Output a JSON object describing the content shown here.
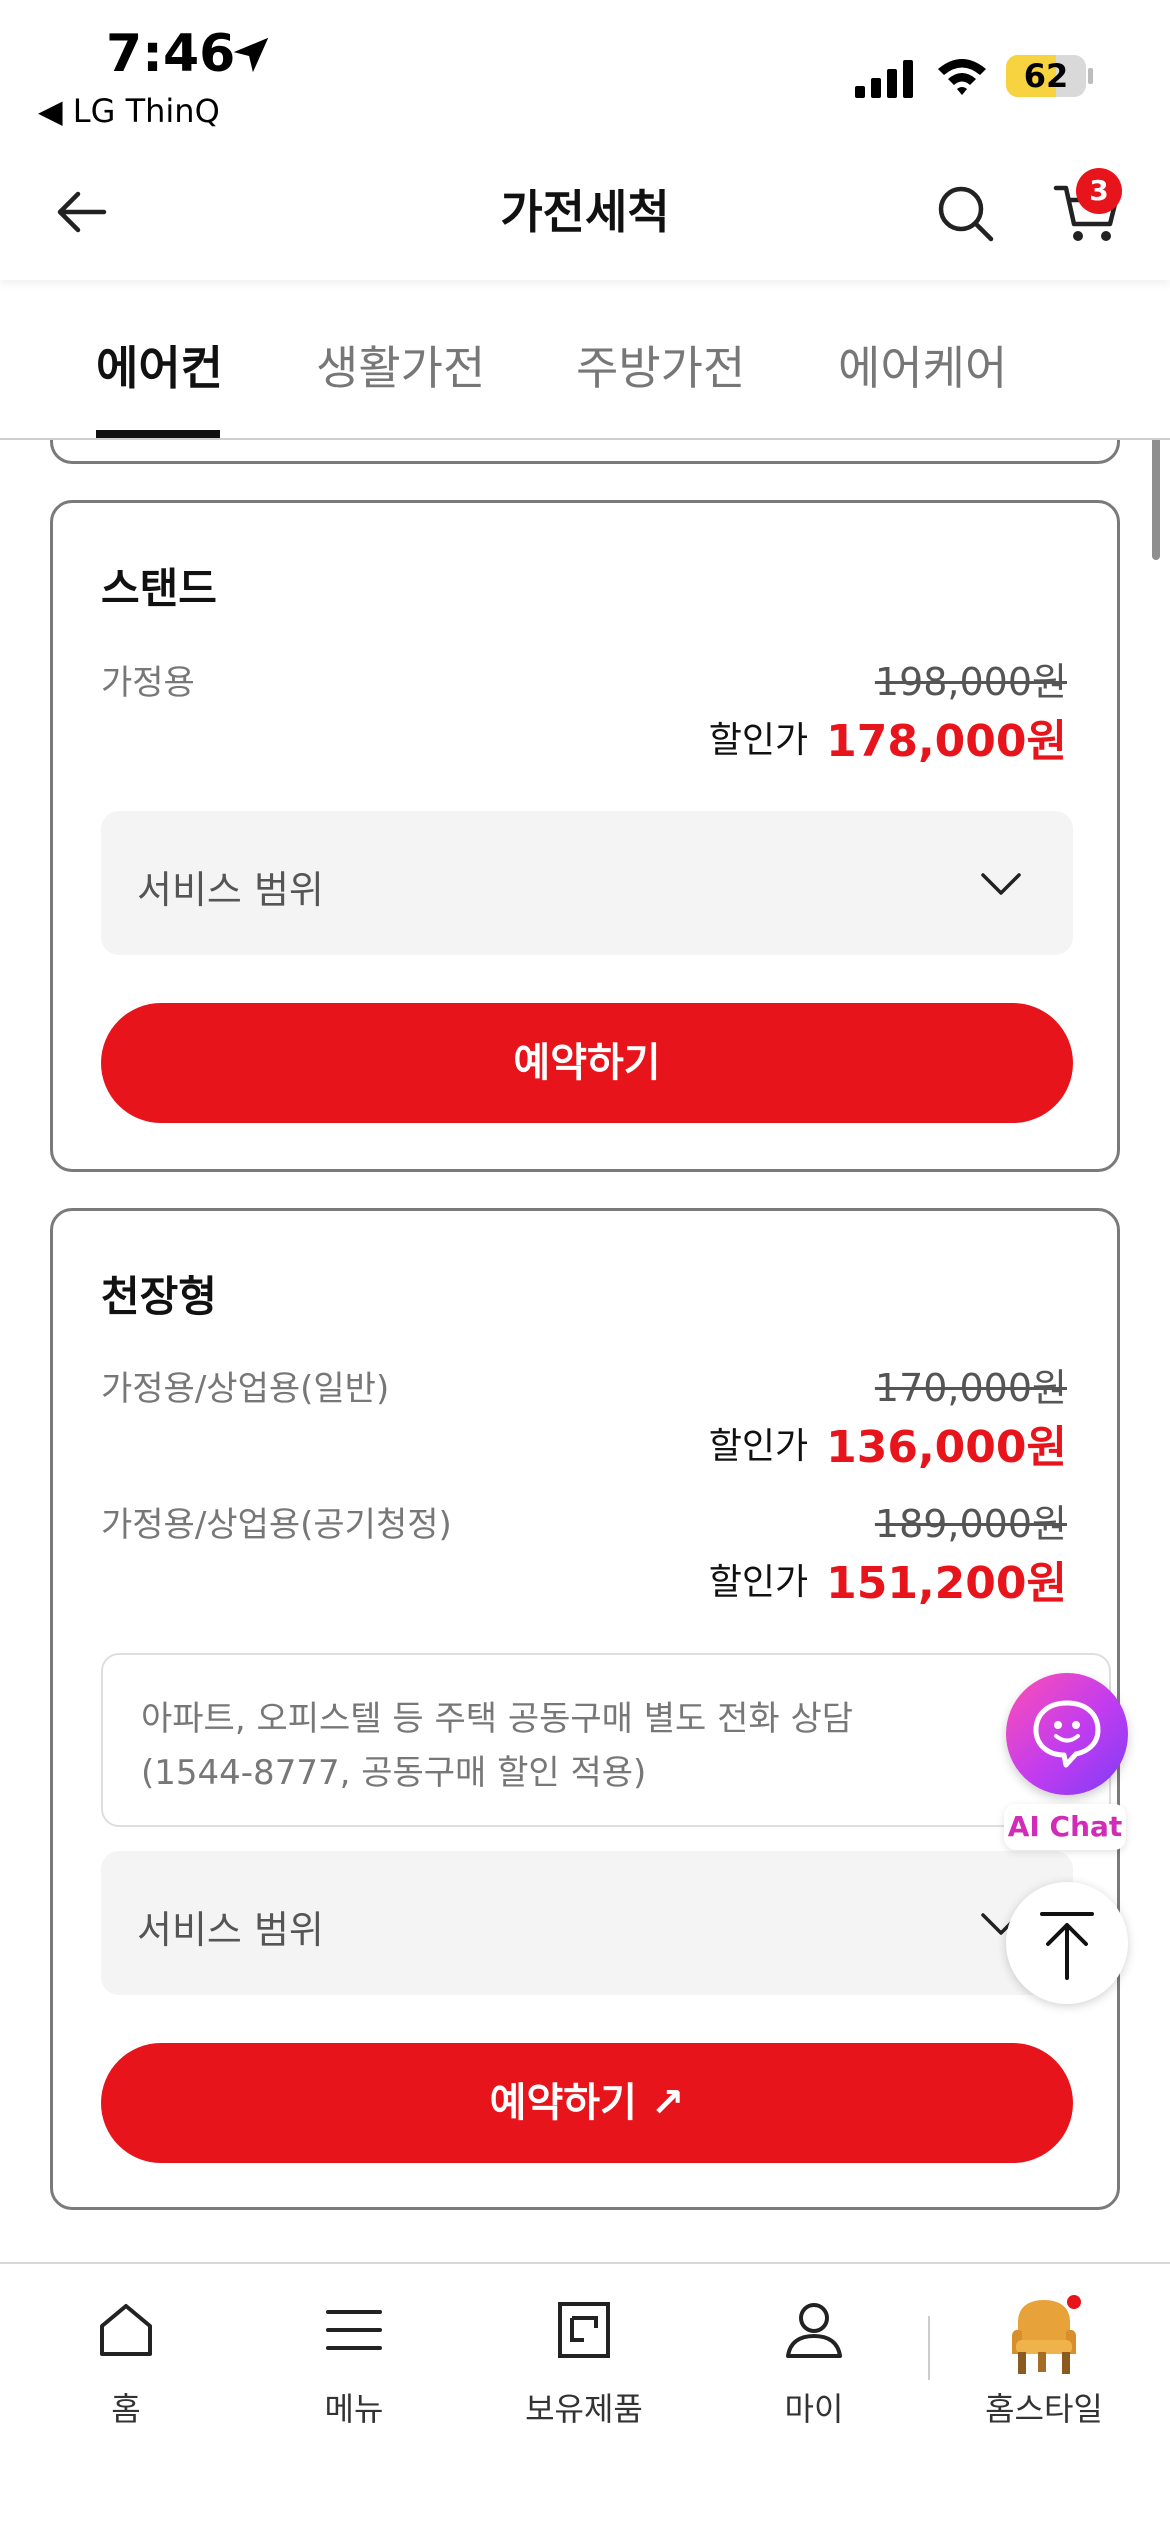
{
  "status_bar": {
    "time": "7:46",
    "back_app": "◀ LG ThinQ",
    "battery": "62",
    "battery_level": 0.62
  },
  "header": {
    "title": "가전세척",
    "cart_count": "3"
  },
  "tabs": [
    {
      "label": "에어컨",
      "active": true
    },
    {
      "label": "생활가전",
      "active": false
    },
    {
      "label": "주방가전",
      "active": false
    },
    {
      "label": "에어케어",
      "active": false
    }
  ],
  "cards": {
    "stand": {
      "title": "스탠드",
      "rows": [
        {
          "label": "가정용",
          "original_price": "198,000원",
          "sale_label": "할인가",
          "sale_price": "178,000원"
        }
      ],
      "select_label": "서비스 범위",
      "button_label": "예약하기"
    },
    "ceiling": {
      "title": "천장형",
      "rows": [
        {
          "label": "가정용/상업용(일반)",
          "original_price": "170,000원",
          "sale_label": "할인가",
          "sale_price": "136,000원"
        },
        {
          "label": "가정용/상업용(공기청정)",
          "original_price": "189,000원",
          "sale_label": "할인가",
          "sale_price": "151,200원"
        }
      ],
      "notice_line1": "아파트, 오피스텔 등 주택 공동구매 별도 전화 상담",
      "notice_line2": "(1544-8777, 공동구매 할인 적용)",
      "select_label": "서비스 범위",
      "button_label": "예약하기 ↗"
    }
  },
  "floating": {
    "ai_chat_label": "AI Chat"
  },
  "bottom_nav": [
    {
      "label": "홈",
      "icon": "home-icon"
    },
    {
      "label": "메뉴",
      "icon": "menu-icon"
    },
    {
      "label": "보유제품",
      "icon": "owned-products-icon"
    },
    {
      "label": "마이",
      "icon": "person-icon"
    },
    {
      "label": "홈스타일",
      "icon": "homestyle-chair-icon"
    }
  ],
  "colors": {
    "accent": "#e8141b",
    "text": "#111111",
    "muted": "#777777",
    "battery": "#f7d33f"
  }
}
